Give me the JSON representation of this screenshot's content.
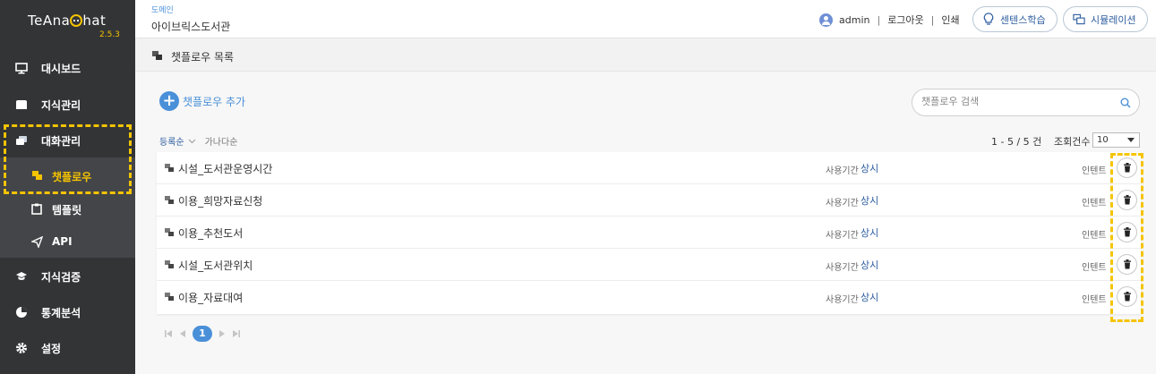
{
  "app": {
    "logo_text_pre": "TeAna",
    "logo_text_post": "hat",
    "version": "2.5.3"
  },
  "sidebar": {
    "items": [
      {
        "label": "대시보드",
        "icon": "monitor-icon"
      },
      {
        "label": "지식관리",
        "icon": "folder-icon"
      },
      {
        "label": "대화관리",
        "icon": "chat-icon"
      },
      {
        "label": "지식검증",
        "icon": "graduation-cap-icon"
      },
      {
        "label": "통계분석",
        "icon": "pie-chart-icon"
      },
      {
        "label": "설정",
        "icon": "gear-icon"
      }
    ],
    "sub_items": [
      {
        "label": "챗플로우",
        "icon": "flow-icon",
        "active": true
      },
      {
        "label": "템플릿",
        "icon": "clipboard-icon"
      },
      {
        "label": "API",
        "icon": "send-icon"
      }
    ],
    "accent_color": "#f5c400"
  },
  "header": {
    "domain_label": "도메인",
    "domain_value": "아이브릭스도서관",
    "username": "admin",
    "logout": "로그아웃",
    "print": "인쇄",
    "sentence_learning": "센텐스학습",
    "simulation": "시뮬레이션"
  },
  "page": {
    "title": "챗플로우 목록",
    "add_label": "챗플로우 추가",
    "search_placeholder": "챗플로우 검색",
    "sort_active": "등록순",
    "sort_other": "가나다순",
    "count": "1 - 5 / 5 건",
    "page_size_label": "조회건수",
    "page_size_value": "10",
    "current_page": "1"
  },
  "rows": [
    {
      "name": "시설_도서관운영시간",
      "period_label": "사용기간",
      "period_value": "상시",
      "intent_label": "인텐트"
    },
    {
      "name": "이용_희망자료신청",
      "period_label": "사용기간",
      "period_value": "상시",
      "intent_label": "인텐트"
    },
    {
      "name": "이용_추천도서",
      "period_label": "사용기간",
      "period_value": "상시",
      "intent_label": "인텐트"
    },
    {
      "name": "시설_도서관위치",
      "period_label": "사용기간",
      "period_value": "상시",
      "intent_label": "인텐트"
    },
    {
      "name": "이용_자료대여",
      "period_label": "사용기간",
      "period_value": "상시",
      "intent_label": "인텐트"
    }
  ],
  "colors": {
    "sidebar_bg": "#333436",
    "link_blue": "#4a90d9",
    "highlight": "#f5c400"
  }
}
